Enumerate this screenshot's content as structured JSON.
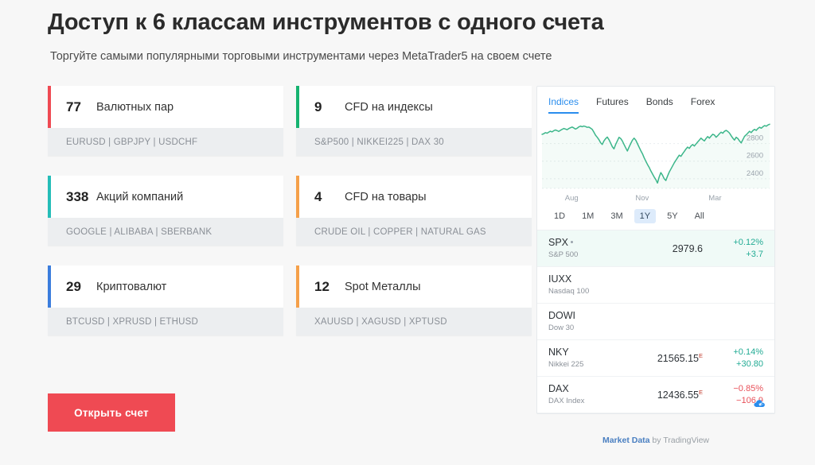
{
  "header": {
    "title": "Доступ к 6 классам инструментов с одного счета",
    "subtitle": "Торгуйте самыми популярными торговыми инструментами через MetaTrader5 на своем счете"
  },
  "cards_left": [
    {
      "count": "77",
      "label": "Валютных пар",
      "symbols": "EURUSD  |  GBPJPY  |  USDCHF",
      "accent": "#ef4a53"
    },
    {
      "count": "338",
      "label": "Акций компаний",
      "symbols": "GOOGLE  |  ALIBABA  |  SBERBANK",
      "accent": "#25bdb8"
    },
    {
      "count": "29",
      "label": "Криптовалют",
      "symbols": "BTCUSD  |  XPRUSD  |  ETHUSD",
      "accent": "#3b7ddd"
    }
  ],
  "cards_right": [
    {
      "count": "9",
      "label": "CFD на индексы",
      "symbols": "S&P500  |  NIKKEI225  |  DAX 30",
      "accent": "#15b370"
    },
    {
      "count": "4",
      "label": "CFD на товары",
      "symbols": "CRUDE OIL  |  COPPER  |  NATURAL GAS",
      "accent": "#f5a04a"
    },
    {
      "count": "12",
      "label": "Spot Металлы",
      "symbols": "XAUUSD  |  XAGUSD  |  XPTUSD",
      "accent": "#f5a04a"
    }
  ],
  "cta": {
    "label": "Открыть счет",
    "color": "#ef4a53"
  },
  "widget": {
    "tabs": [
      {
        "label": "Indices",
        "active": true
      },
      {
        "label": "Futures",
        "active": false
      },
      {
        "label": "Bonds",
        "active": false
      },
      {
        "label": "Forex",
        "active": false
      }
    ],
    "ranges": [
      {
        "label": "1D",
        "active": false
      },
      {
        "label": "1M",
        "active": false
      },
      {
        "label": "3M",
        "active": false
      },
      {
        "label": "1Y",
        "active": true
      },
      {
        "label": "5Y",
        "active": false
      },
      {
        "label": "All",
        "active": false
      }
    ],
    "rows": [
      {
        "symbol": "SPX",
        "has_dot": true,
        "desc": "S&P 500",
        "price": "2979.6",
        "price_sup": "",
        "pct": "+0.12%",
        "abs": "+3.7",
        "dir": "up",
        "highlight": true,
        "cloud": false
      },
      {
        "symbol": "IUXX",
        "has_dot": false,
        "desc": "Nasdaq 100",
        "price": "",
        "price_sup": "",
        "pct": "",
        "abs": "",
        "dir": "up",
        "highlight": false,
        "cloud": false
      },
      {
        "symbol": "DOWI",
        "has_dot": false,
        "desc": "Dow 30",
        "price": "",
        "price_sup": "",
        "pct": "",
        "abs": "",
        "dir": "up",
        "highlight": false,
        "cloud": false
      },
      {
        "symbol": "NKY",
        "has_dot": false,
        "desc": "Nikkei 225",
        "price": "21565.15",
        "price_sup": "E",
        "pct": "+0.14%",
        "abs": "+30.80",
        "dir": "up",
        "highlight": false,
        "cloud": false
      },
      {
        "symbol": "DAX",
        "has_dot": false,
        "desc": "DAX Index",
        "price": "12436.55",
        "price_sup": "E",
        "pct": "−0.85%",
        "abs": "−106.9",
        "dir": "down",
        "highlight": false,
        "cloud": true
      }
    ],
    "footer_brand": "Market Data",
    "footer_rest": " by TradingView"
  },
  "chart_data": {
    "type": "line",
    "title": "",
    "xlabel": "",
    "ylabel": "",
    "line_color": "#3cb68a",
    "fill_color": "rgba(60,182,138,0.06)",
    "grid": true,
    "ylim": [
      2290,
      3050
    ],
    "yticks": [
      2400,
      2600,
      2800
    ],
    "ytick_labels": [
      "2400",
      "2600",
      "2800"
    ],
    "xticks": [
      0.13,
      0.44,
      0.76
    ],
    "xtick_labels": [
      "Aug",
      "Nov",
      "Mar"
    ],
    "values": [
      2905,
      2912,
      2925,
      2918,
      2930,
      2941,
      2933,
      2946,
      2955,
      2948,
      2938,
      2951,
      2962,
      2972,
      2966,
      2958,
      2971,
      2980,
      2988,
      2978,
      2965,
      2975,
      2990,
      2999,
      2992,
      3000,
      2994,
      2985,
      2988,
      2976,
      2962,
      2930,
      2895,
      2872,
      2845,
      2810,
      2790,
      2830,
      2856,
      2874,
      2845,
      2806,
      2765,
      2740,
      2790,
      2830,
      2871,
      2858,
      2830,
      2790,
      2752,
      2716,
      2760,
      2800,
      2838,
      2862,
      2840,
      2800,
      2760,
      2720,
      2685,
      2640,
      2600,
      2563,
      2530,
      2490,
      2455,
      2420,
      2390,
      2351,
      2420,
      2470,
      2440,
      2400,
      2380,
      2430,
      2475,
      2510,
      2545,
      2580,
      2610,
      2640,
      2668,
      2655,
      2684,
      2710,
      2738,
      2760,
      2745,
      2772,
      2790,
      2772,
      2795,
      2818,
      2840,
      2862,
      2845,
      2830,
      2858,
      2880,
      2862,
      2885,
      2906,
      2898,
      2872,
      2890,
      2912,
      2930,
      2918,
      2940,
      2950,
      2938,
      2920,
      2890,
      2862,
      2840,
      2872,
      2858,
      2830,
      2808,
      2845,
      2882,
      2900,
      2920,
      2940,
      2925,
      2948,
      2962,
      2950,
      2972,
      2986,
      2975,
      2992,
      3005,
      2998,
      3012,
      3020
    ]
  }
}
